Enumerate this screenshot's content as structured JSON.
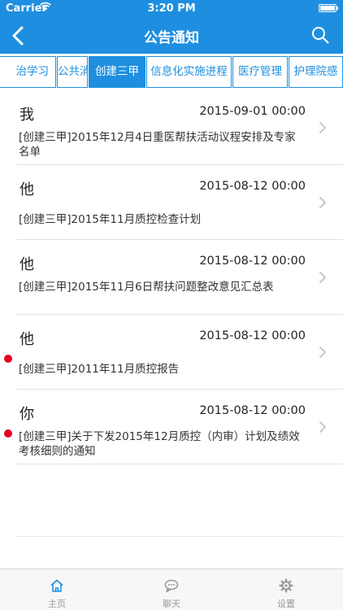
{
  "status_bar": {
    "carrier": "Carrier",
    "time": "3:20 PM",
    "battery_level": 1.0
  },
  "nav": {
    "title": "公告通知",
    "back_icon": "chevron-left-icon",
    "search_icon": "search-icon"
  },
  "tabs": [
    {
      "label": "治学习",
      "active": false
    },
    {
      "label": "公共消息",
      "active": false
    },
    {
      "label": "创建三甲",
      "active": true
    },
    {
      "label": "信息化实施进程",
      "active": false
    },
    {
      "label": "医疗管理",
      "active": false
    },
    {
      "label": "护理院感",
      "active": false
    }
  ],
  "items": [
    {
      "sender": "我",
      "date": "2015-09-01 00:00",
      "subject": "[创建三甲]2015年12月4日重医帮扶活动议程安排及专家名单",
      "unread": false
    },
    {
      "sender": "他",
      "date": "2015-08-12 00:00",
      "subject": "[创建三甲]2015年11月质控检查计划",
      "unread": false
    },
    {
      "sender": "他",
      "date": "2015-08-12 00:00",
      "subject": "[创建三甲]2015年11月6日帮扶问题整改意见汇总表",
      "unread": false
    },
    {
      "sender": "他",
      "date": "2015-08-12 00:00",
      "subject": "[创建三甲]2011年11月质控报告",
      "unread": true
    },
    {
      "sender": "你",
      "date": "2015-08-12 00:00",
      "subject": "[创建三甲]关于下发2015年12月质控（内审）计划及绩效考核细则的通知",
      "unread": true
    }
  ],
  "tabbar": [
    {
      "label": "主页",
      "icon": "home-icon",
      "active": true
    },
    {
      "label": "聊天",
      "icon": "chat-icon",
      "active": false
    },
    {
      "label": "设置",
      "icon": "gear-icon",
      "active": false
    }
  ],
  "colors": {
    "accent": "#1e8fe0",
    "unread_dot": "#e6001e"
  }
}
